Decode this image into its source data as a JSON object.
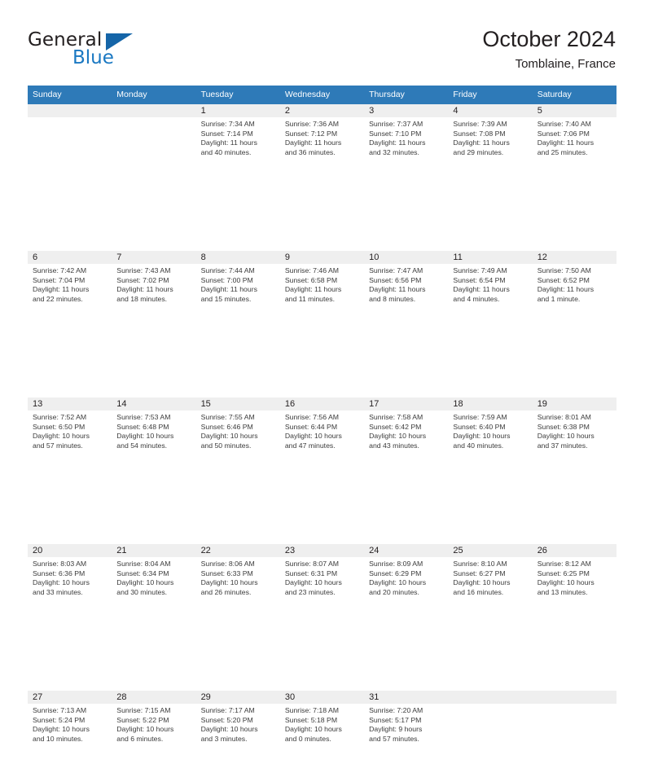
{
  "brand": {
    "name_part1": "General",
    "name_part2": "Blue",
    "logo_icon": "triangle-logo-icon",
    "accent_color": "#1a78c2"
  },
  "header": {
    "title": "October 2024",
    "location": "Tomblaine, France"
  },
  "theme": {
    "header_bar_color": "#2e7ab8",
    "day_band_color": "#efefef",
    "text_color": "#231f20"
  },
  "calendar": {
    "weekday_headers": [
      "Sunday",
      "Monday",
      "Tuesday",
      "Wednesday",
      "Thursday",
      "Friday",
      "Saturday"
    ],
    "weeks": [
      [
        {
          "day": "",
          "sunrise": "",
          "sunset": "",
          "daylight1": "",
          "daylight2": ""
        },
        {
          "day": "",
          "sunrise": "",
          "sunset": "",
          "daylight1": "",
          "daylight2": ""
        },
        {
          "day": "1",
          "sunrise": "Sunrise: 7:34 AM",
          "sunset": "Sunset: 7:14 PM",
          "daylight1": "Daylight: 11 hours",
          "daylight2": "and 40 minutes."
        },
        {
          "day": "2",
          "sunrise": "Sunrise: 7:36 AM",
          "sunset": "Sunset: 7:12 PM",
          "daylight1": "Daylight: 11 hours",
          "daylight2": "and 36 minutes."
        },
        {
          "day": "3",
          "sunrise": "Sunrise: 7:37 AM",
          "sunset": "Sunset: 7:10 PM",
          "daylight1": "Daylight: 11 hours",
          "daylight2": "and 32 minutes."
        },
        {
          "day": "4",
          "sunrise": "Sunrise: 7:39 AM",
          "sunset": "Sunset: 7:08 PM",
          "daylight1": "Daylight: 11 hours",
          "daylight2": "and 29 minutes."
        },
        {
          "day": "5",
          "sunrise": "Sunrise: 7:40 AM",
          "sunset": "Sunset: 7:06 PM",
          "daylight1": "Daylight: 11 hours",
          "daylight2": "and 25 minutes."
        }
      ],
      [
        {
          "day": "6",
          "sunrise": "Sunrise: 7:42 AM",
          "sunset": "Sunset: 7:04 PM",
          "daylight1": "Daylight: 11 hours",
          "daylight2": "and 22 minutes."
        },
        {
          "day": "7",
          "sunrise": "Sunrise: 7:43 AM",
          "sunset": "Sunset: 7:02 PM",
          "daylight1": "Daylight: 11 hours",
          "daylight2": "and 18 minutes."
        },
        {
          "day": "8",
          "sunrise": "Sunrise: 7:44 AM",
          "sunset": "Sunset: 7:00 PM",
          "daylight1": "Daylight: 11 hours",
          "daylight2": "and 15 minutes."
        },
        {
          "day": "9",
          "sunrise": "Sunrise: 7:46 AM",
          "sunset": "Sunset: 6:58 PM",
          "daylight1": "Daylight: 11 hours",
          "daylight2": "and 11 minutes."
        },
        {
          "day": "10",
          "sunrise": "Sunrise: 7:47 AM",
          "sunset": "Sunset: 6:56 PM",
          "daylight1": "Daylight: 11 hours",
          "daylight2": "and 8 minutes."
        },
        {
          "day": "11",
          "sunrise": "Sunrise: 7:49 AM",
          "sunset": "Sunset: 6:54 PM",
          "daylight1": "Daylight: 11 hours",
          "daylight2": "and 4 minutes."
        },
        {
          "day": "12",
          "sunrise": "Sunrise: 7:50 AM",
          "sunset": "Sunset: 6:52 PM",
          "daylight1": "Daylight: 11 hours",
          "daylight2": "and 1 minute."
        }
      ],
      [
        {
          "day": "13",
          "sunrise": "Sunrise: 7:52 AM",
          "sunset": "Sunset: 6:50 PM",
          "daylight1": "Daylight: 10 hours",
          "daylight2": "and 57 minutes."
        },
        {
          "day": "14",
          "sunrise": "Sunrise: 7:53 AM",
          "sunset": "Sunset: 6:48 PM",
          "daylight1": "Daylight: 10 hours",
          "daylight2": "and 54 minutes."
        },
        {
          "day": "15",
          "sunrise": "Sunrise: 7:55 AM",
          "sunset": "Sunset: 6:46 PM",
          "daylight1": "Daylight: 10 hours",
          "daylight2": "and 50 minutes."
        },
        {
          "day": "16",
          "sunrise": "Sunrise: 7:56 AM",
          "sunset": "Sunset: 6:44 PM",
          "daylight1": "Daylight: 10 hours",
          "daylight2": "and 47 minutes."
        },
        {
          "day": "17",
          "sunrise": "Sunrise: 7:58 AM",
          "sunset": "Sunset: 6:42 PM",
          "daylight1": "Daylight: 10 hours",
          "daylight2": "and 43 minutes."
        },
        {
          "day": "18",
          "sunrise": "Sunrise: 7:59 AM",
          "sunset": "Sunset: 6:40 PM",
          "daylight1": "Daylight: 10 hours",
          "daylight2": "and 40 minutes."
        },
        {
          "day": "19",
          "sunrise": "Sunrise: 8:01 AM",
          "sunset": "Sunset: 6:38 PM",
          "daylight1": "Daylight: 10 hours",
          "daylight2": "and 37 minutes."
        }
      ],
      [
        {
          "day": "20",
          "sunrise": "Sunrise: 8:03 AM",
          "sunset": "Sunset: 6:36 PM",
          "daylight1": "Daylight: 10 hours",
          "daylight2": "and 33 minutes."
        },
        {
          "day": "21",
          "sunrise": "Sunrise: 8:04 AM",
          "sunset": "Sunset: 6:34 PM",
          "daylight1": "Daylight: 10 hours",
          "daylight2": "and 30 minutes."
        },
        {
          "day": "22",
          "sunrise": "Sunrise: 8:06 AM",
          "sunset": "Sunset: 6:33 PM",
          "daylight1": "Daylight: 10 hours",
          "daylight2": "and 26 minutes."
        },
        {
          "day": "23",
          "sunrise": "Sunrise: 8:07 AM",
          "sunset": "Sunset: 6:31 PM",
          "daylight1": "Daylight: 10 hours",
          "daylight2": "and 23 minutes."
        },
        {
          "day": "24",
          "sunrise": "Sunrise: 8:09 AM",
          "sunset": "Sunset: 6:29 PM",
          "daylight1": "Daylight: 10 hours",
          "daylight2": "and 20 minutes."
        },
        {
          "day": "25",
          "sunrise": "Sunrise: 8:10 AM",
          "sunset": "Sunset: 6:27 PM",
          "daylight1": "Daylight: 10 hours",
          "daylight2": "and 16 minutes."
        },
        {
          "day": "26",
          "sunrise": "Sunrise: 8:12 AM",
          "sunset": "Sunset: 6:25 PM",
          "daylight1": "Daylight: 10 hours",
          "daylight2": "and 13 minutes."
        }
      ],
      [
        {
          "day": "27",
          "sunrise": "Sunrise: 7:13 AM",
          "sunset": "Sunset: 5:24 PM",
          "daylight1": "Daylight: 10 hours",
          "daylight2": "and 10 minutes."
        },
        {
          "day": "28",
          "sunrise": "Sunrise: 7:15 AM",
          "sunset": "Sunset: 5:22 PM",
          "daylight1": "Daylight: 10 hours",
          "daylight2": "and 6 minutes."
        },
        {
          "day": "29",
          "sunrise": "Sunrise: 7:17 AM",
          "sunset": "Sunset: 5:20 PM",
          "daylight1": "Daylight: 10 hours",
          "daylight2": "and 3 minutes."
        },
        {
          "day": "30",
          "sunrise": "Sunrise: 7:18 AM",
          "sunset": "Sunset: 5:18 PM",
          "daylight1": "Daylight: 10 hours",
          "daylight2": "and 0 minutes."
        },
        {
          "day": "31",
          "sunrise": "Sunrise: 7:20 AM",
          "sunset": "Sunset: 5:17 PM",
          "daylight1": "Daylight: 9 hours",
          "daylight2": "and 57 minutes."
        },
        {
          "day": "",
          "sunrise": "",
          "sunset": "",
          "daylight1": "",
          "daylight2": ""
        },
        {
          "day": "",
          "sunrise": "",
          "sunset": "",
          "daylight1": "",
          "daylight2": ""
        }
      ]
    ]
  }
}
